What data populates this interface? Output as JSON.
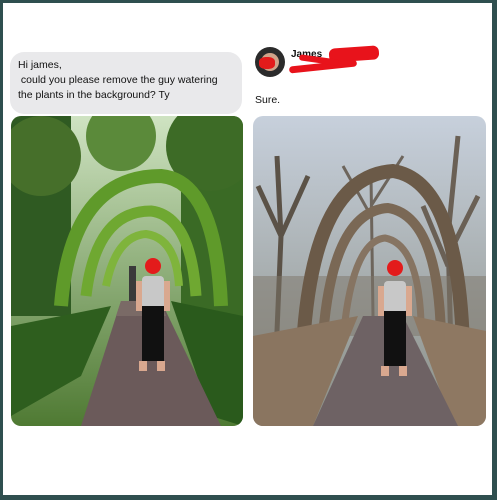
{
  "request": {
    "lines": [
      "Hi james,",
      " could you please remove the guy watering",
      "the plants in the background? Ty"
    ]
  },
  "response": {
    "author": "James",
    "text": "Sure."
  },
  "images": {
    "left": "original-photo-garden-archway",
    "right": "edited-photo-bare-branch-archway"
  },
  "colors": {
    "bubble": "#e9e9eb",
    "redaction": "#e8131b",
    "frame": "#2f4f4f"
  }
}
